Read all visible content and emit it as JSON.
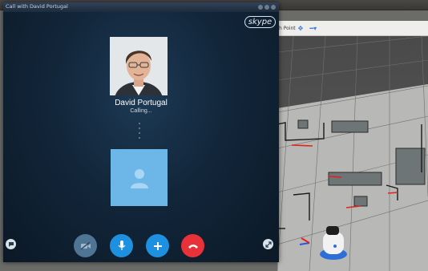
{
  "window": {
    "title": "Call with David Portugal",
    "logo_text": "skype"
  },
  "contact": {
    "name": "David Portugal",
    "status": "Calling..."
  },
  "controls": [
    {
      "name": "video-toggle",
      "icon": "video-off-icon",
      "color": "#5a7f9e"
    },
    {
      "name": "microphone",
      "icon": "microphone-icon",
      "color": "#1e90e0"
    },
    {
      "name": "add",
      "icon": "plus-icon",
      "color": "#1e90e0"
    },
    {
      "name": "end-call",
      "icon": "phone-hangup-icon",
      "color": "#e8323a"
    }
  ],
  "side_controls": {
    "chat_icon": "chat-icon",
    "fullscreen_icon": "expand-icon"
  },
  "background_app": {
    "toolbar_label": "h Point",
    "toolbar_icons": [
      "plus-move-icon",
      "minus-dropdown-icon"
    ]
  },
  "colors": {
    "skype_blue": "#1e90e0",
    "hangup_red": "#e8323a",
    "avatar_bg": "#6db7e8"
  }
}
